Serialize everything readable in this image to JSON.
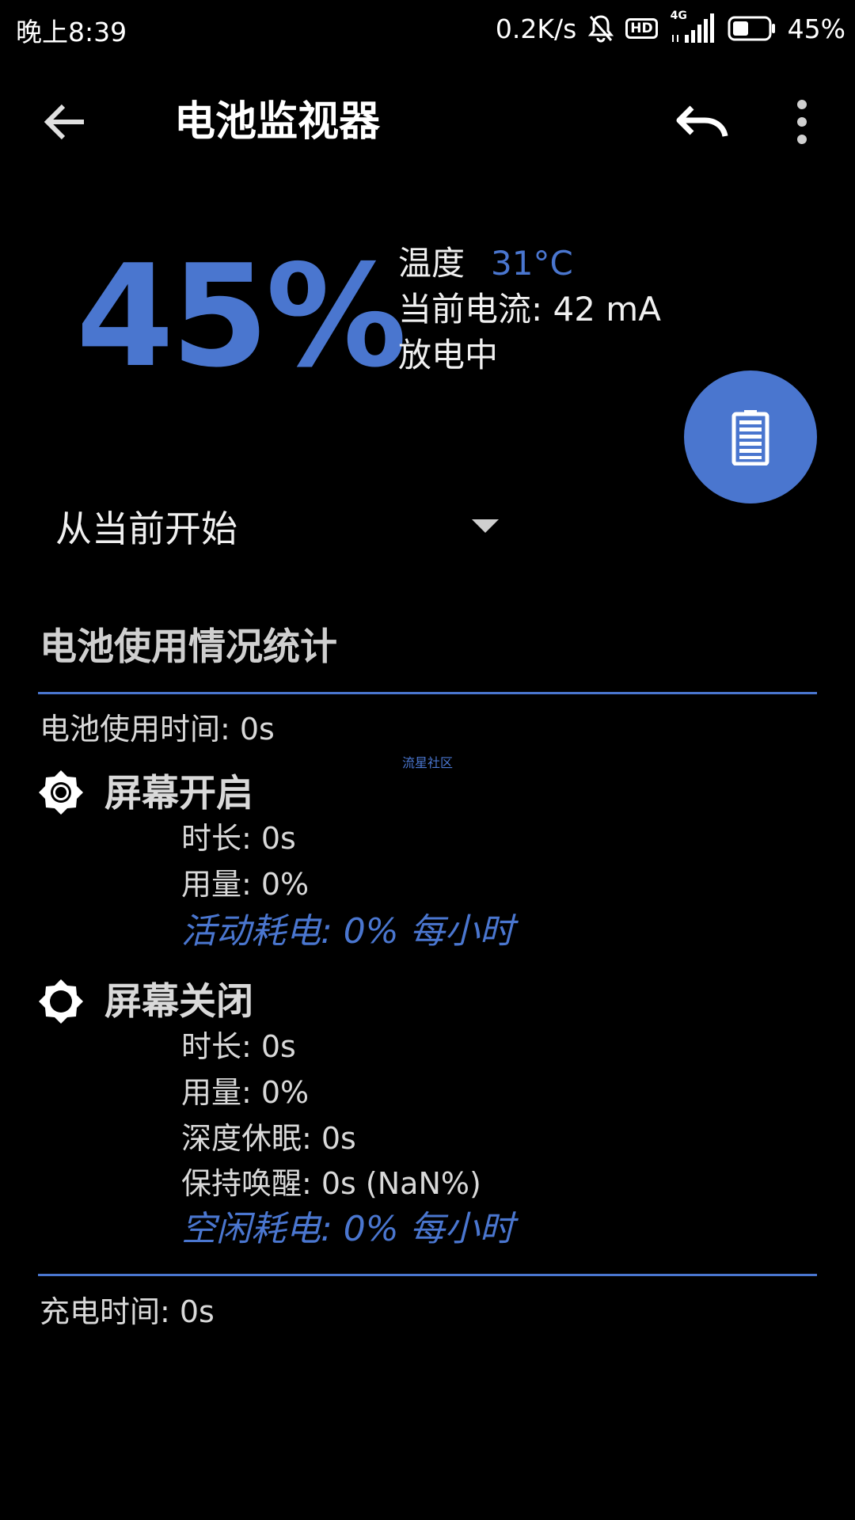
{
  "status_bar": {
    "time": "晚上8:39",
    "net_speed": "0.2K/s",
    "hd": "HD",
    "network": "4G",
    "battery_pct": "45%",
    "battery_level": 0.45
  },
  "app_bar": {
    "title": "电池监视器"
  },
  "hero": {
    "percent": "45%",
    "temp_label": "温度",
    "temp_value": "31°C",
    "current": "当前电流: 42 mA",
    "state": "放电中"
  },
  "dropdown": {
    "selected": "从当前开始"
  },
  "stats": {
    "title": "电池使用情况统计",
    "battery_time": "电池使用时间:  0s",
    "watermark": "流星社区",
    "screen_on": {
      "title": "屏幕开启",
      "duration": "时长:  0s",
      "usage": "用量:  0%",
      "rate": "活动耗电: 0% 每小时"
    },
    "screen_off": {
      "title": "屏幕关闭",
      "duration": "时长:  0s",
      "usage": "用量:  0%",
      "deep_sleep": "深度休眠:  0s",
      "awake": "保持唤醒:  0s (NaN%)",
      "rate": "空闲耗电: 0% 每小时"
    },
    "charge_time": "充电时间:  0s"
  },
  "colors": {
    "accent": "#4a76cf",
    "background": "#000000"
  }
}
